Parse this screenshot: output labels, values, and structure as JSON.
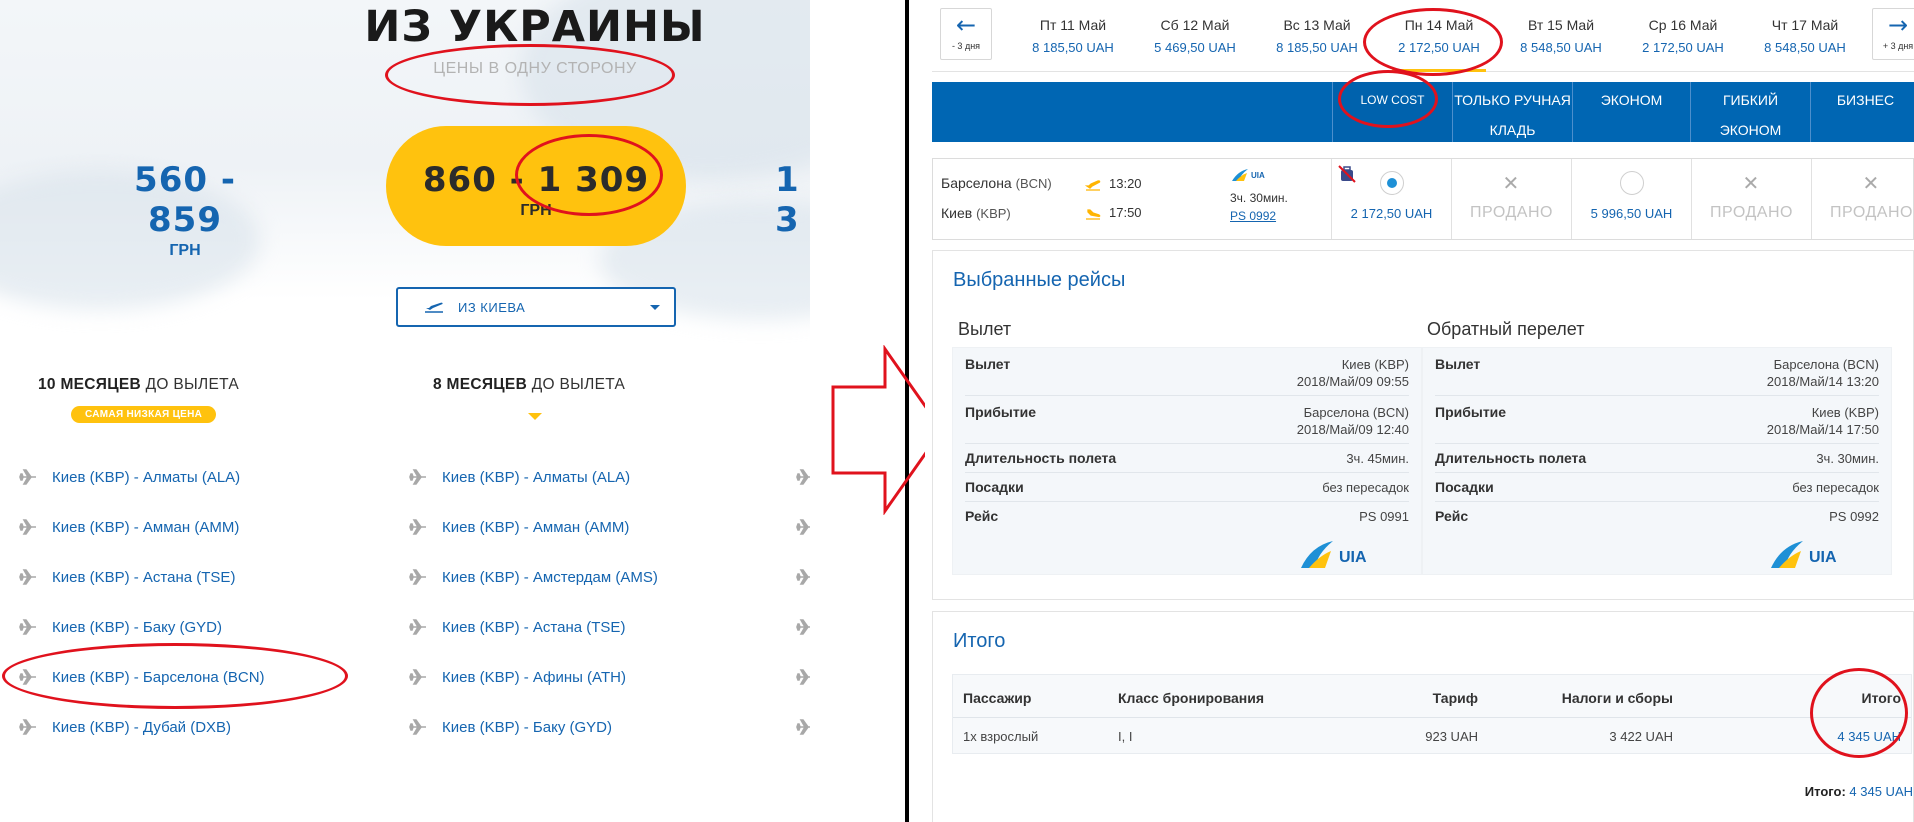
{
  "left": {
    "title": "ИЗ УКРАИНЫ",
    "subtitle": "ЦЕНЫ В ОДНУ СТОРОНУ",
    "price_ranges": [
      {
        "range": "560 - 859",
        "currency": "ГРН"
      },
      {
        "range": "860 - 1 309",
        "currency": "ГРН"
      },
      {
        "range": "1 3",
        "currency": ""
      }
    ],
    "origin_select": {
      "value": "ИЗ КИЕВА",
      "icon": "plane-takeoff-icon"
    },
    "columns": [
      {
        "months": "10 МЕСЯЦЕВ",
        "suffix": "ДО ВЫЛЕТА",
        "badge": "САМАЯ НИЗКАЯ ЦЕНА",
        "routes": [
          "Киев (KBP) - Алматы (ALA)",
          "Киев (KBP) - Амман (AMM)",
          "Киев (KBP) - Астана (TSE)",
          "Киев (KBP) - Баку (GYD)",
          "Киев (KBP) - Барселона (BCN)",
          "Киев (KBP) - Дубай (DXB)"
        ]
      },
      {
        "months": "8 МЕСЯЦЕВ",
        "suffix": "ДО ВЫЛЕТА",
        "routes": [
          "Киев (KBP) - Алматы (ALA)",
          "Киев (KBP) - Амман (AMM)",
          "Киев (KBP) - Амстердам (AMS)",
          "Киев (KBP) - Астана (TSE)",
          "Киев (KBP) - Афины (ATH)",
          "Киев (KBP) - Баку (GYD)"
        ]
      }
    ]
  },
  "right": {
    "nav": {
      "prev_label": "- 3 дня",
      "next_label": "+ 3 дня"
    },
    "dates": [
      {
        "day": "Пт 11 Май",
        "price": "8 185,50 UAH"
      },
      {
        "day": "Сб 12 Май",
        "price": "5 469,50 UAH"
      },
      {
        "day": "Вс 13 Май",
        "price": "8 185,50 UAH"
      },
      {
        "day": "Пн 14 Май",
        "price": "2 172,50 UAH"
      },
      {
        "day": "Вт 15 Май",
        "price": "8 548,50 UAH"
      },
      {
        "day": "Ср 16 Май",
        "price": "2 172,50 UAH"
      },
      {
        "day": "Чт 17 Май",
        "price": "8 548,50 UAH"
      }
    ],
    "classes": [
      "LOW COST",
      "ТОЛЬКО РУЧНАЯ КЛАДЬ",
      "ЭКОНОМ",
      "ГИБКИЙ ЭКОНОМ",
      "БИЗНЕС"
    ],
    "flight": {
      "from_city": "Барселона",
      "from_code": "(BCN)",
      "dep_time": "13:20",
      "to_city": "Киев",
      "to_code": "(KBP)",
      "arr_time": "17:50",
      "duration": "3ч. 30мин.",
      "number": "PS 0992",
      "airline_mini": "UIA",
      "lowcost_price": "2 172,50 UAH",
      "economy_price": "5 996,50 UAH",
      "sold": "ПРОДАНО"
    },
    "selected": {
      "title": "Выбранные рейсы",
      "outbound": {
        "title": "Вылет",
        "rows": [
          {
            "key": "Вылет",
            "val1": "Киев (KBP)",
            "val2": "2018/Май/09 09:55"
          },
          {
            "key": "Прибытие",
            "val1": "Барселона (BCN)",
            "val2": "2018/Май/09 12:40"
          },
          {
            "key": "Длительность полета",
            "val1": "3ч. 45мин."
          },
          {
            "key": "Посадки",
            "val1": "без пересадок"
          },
          {
            "key": "Рейс",
            "val1": "PS 0991"
          }
        ]
      },
      "return": {
        "title": "Обратный перелет",
        "rows": [
          {
            "key": "Вылет",
            "val1": "Барселона (BCN)",
            "val2": "2018/Май/14 13:20"
          },
          {
            "key": "Прибытие",
            "val1": "Киев (KBP)",
            "val2": "2018/Май/14 17:50"
          },
          {
            "key": "Длительность полета",
            "val1": "3ч. 30мин."
          },
          {
            "key": "Посадки",
            "val1": "без пересадок"
          },
          {
            "key": "Рейс",
            "val1": "PS 0992"
          }
        ]
      },
      "airline_logo_text": "UIA"
    },
    "summary": {
      "title": "Итого",
      "headers": {
        "passenger": "Пассажир",
        "booking_class": "Класс бронирования",
        "fare": "Тариф",
        "taxes": "Налоги и сборы",
        "total": "Итого"
      },
      "row": {
        "passenger": "1х взрослый",
        "booking_class": "I, I",
        "fare": "923 UAH",
        "taxes": "3 422 UAH",
        "total": "4 345 UAH"
      },
      "grand_total_label": "Итого:",
      "grand_total_value": "4 345 UAH"
    }
  },
  "colors": {
    "brand_blue": "#0066b3",
    "link_blue": "#1565b0",
    "yellow": "#ffc20e",
    "annotation_red": "#e0121d"
  }
}
